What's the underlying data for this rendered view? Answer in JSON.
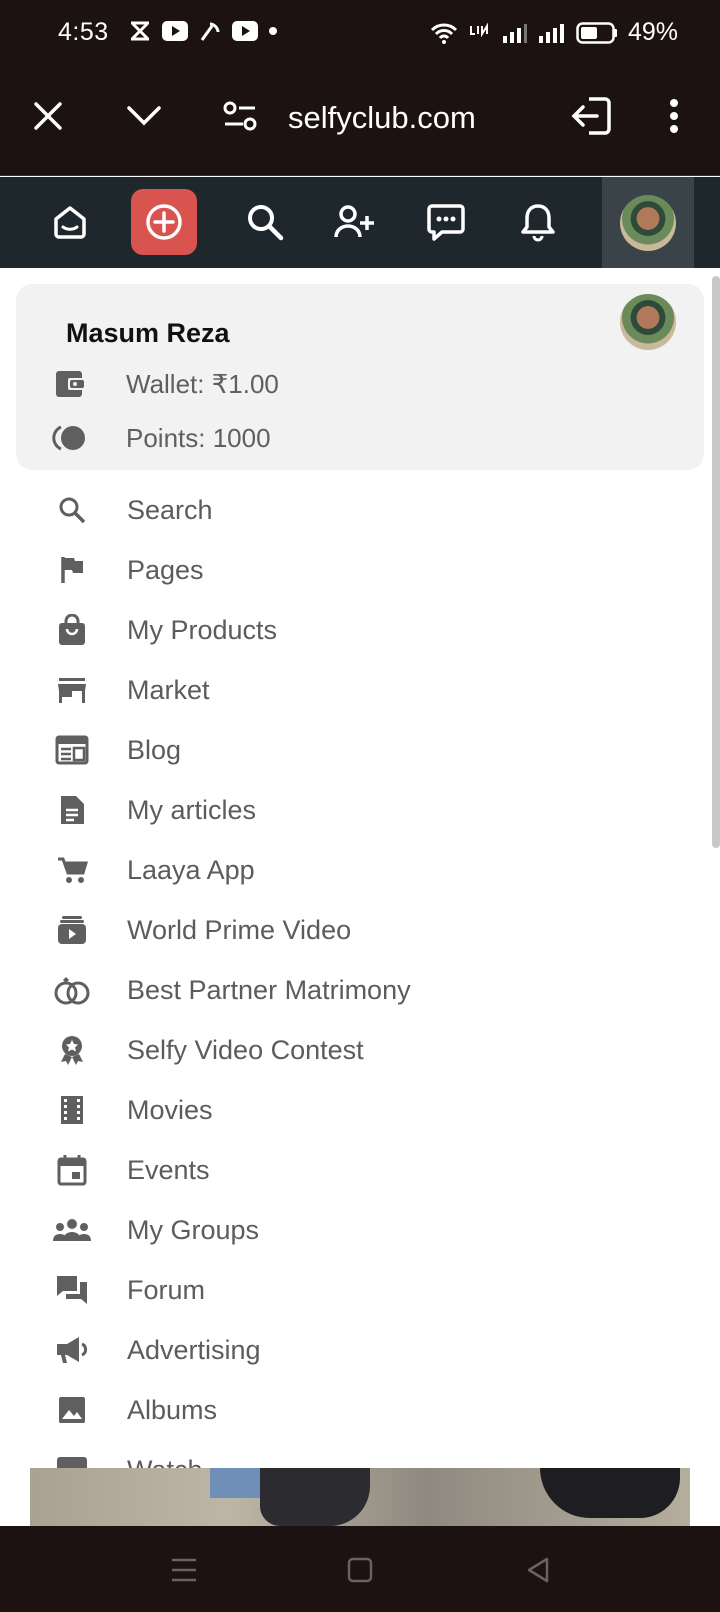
{
  "status_bar": {
    "time": "4:53",
    "battery": "49%"
  },
  "browser": {
    "url": "selfyclub.com"
  },
  "user": {
    "name": "Masum Reza",
    "wallet": "Wallet: ₹1.00",
    "points": "Points: 1000"
  },
  "menu": [
    {
      "label": "Search",
      "icon": "search-icon"
    },
    {
      "label": "Pages",
      "icon": "flag-icon"
    },
    {
      "label": "My Products",
      "icon": "shopping-bag-icon"
    },
    {
      "label": "Market",
      "icon": "store-icon"
    },
    {
      "label": "Blog",
      "icon": "newspaper-icon"
    },
    {
      "label": "My articles",
      "icon": "document-icon"
    },
    {
      "label": "Laaya App",
      "icon": "cart-icon"
    },
    {
      "label": "World Prime Video",
      "icon": "video-library-icon"
    },
    {
      "label": "Best Partner Matrimony",
      "icon": "rings-icon"
    },
    {
      "label": "Selfy Video Contest",
      "icon": "award-icon"
    },
    {
      "label": "Movies",
      "icon": "film-icon"
    },
    {
      "label": "Events",
      "icon": "calendar-icon"
    },
    {
      "label": "My Groups",
      "icon": "groups-icon"
    },
    {
      "label": "Forum",
      "icon": "forum-icon"
    },
    {
      "label": "Advertising",
      "icon": "megaphone-icon"
    },
    {
      "label": "Albums",
      "icon": "image-icon"
    },
    {
      "label": "Watch",
      "icon": "watch-icon"
    }
  ],
  "colors": {
    "system_bar": "#1b1211",
    "site_nav": "#1e272c",
    "accent_add": "#d9534f",
    "card_bg": "#f2f2f2",
    "menu_text": "#5c5c5c"
  }
}
